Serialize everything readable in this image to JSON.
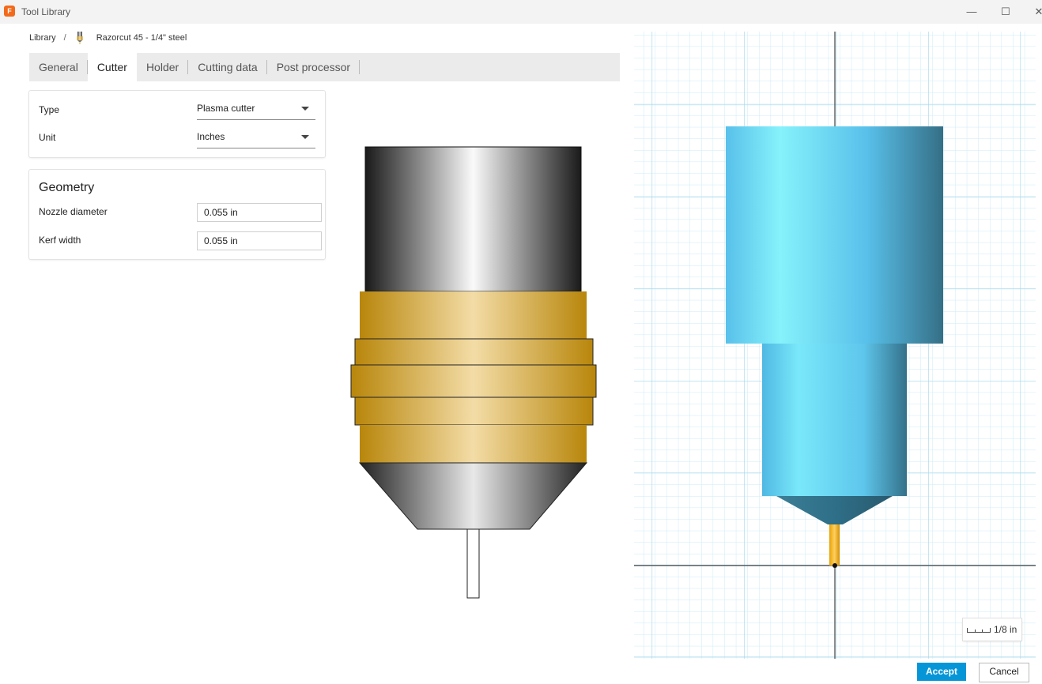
{
  "window": {
    "app_icon_letter": "F",
    "title": "Tool Library",
    "controls": {
      "minimize": "—",
      "maximize": "☐",
      "close": "✕"
    }
  },
  "breadcrumb": {
    "root": "Library",
    "separator": "/",
    "current": "Razorcut 45 - 1/4\" steel"
  },
  "tabs": [
    {
      "label": "General",
      "active": false
    },
    {
      "label": "Cutter",
      "active": true
    },
    {
      "label": "Holder",
      "active": false
    },
    {
      "label": "Cutting data",
      "active": false
    },
    {
      "label": "Post processor",
      "active": false
    }
  ],
  "cutter": {
    "type_label": "Type",
    "type_value": "Plasma cutter",
    "unit_label": "Unit",
    "unit_value": "Inches"
  },
  "geometry": {
    "title": "Geometry",
    "nozzle_diameter_label": "Nozzle diameter",
    "nozzle_diameter_value": "0.055 in",
    "kerf_width_label": "Kerf width",
    "kerf_width_value": "0.055 in"
  },
  "viewport": {
    "scale_label": "1/8 in"
  },
  "footer": {
    "accept_label": "Accept",
    "cancel_label": "Cancel"
  },
  "colors": {
    "accent": "#0696d7",
    "grid_line": "#bfe4f2",
    "tool_blue": "#6fd3f5",
    "brass": "#c8951a"
  }
}
